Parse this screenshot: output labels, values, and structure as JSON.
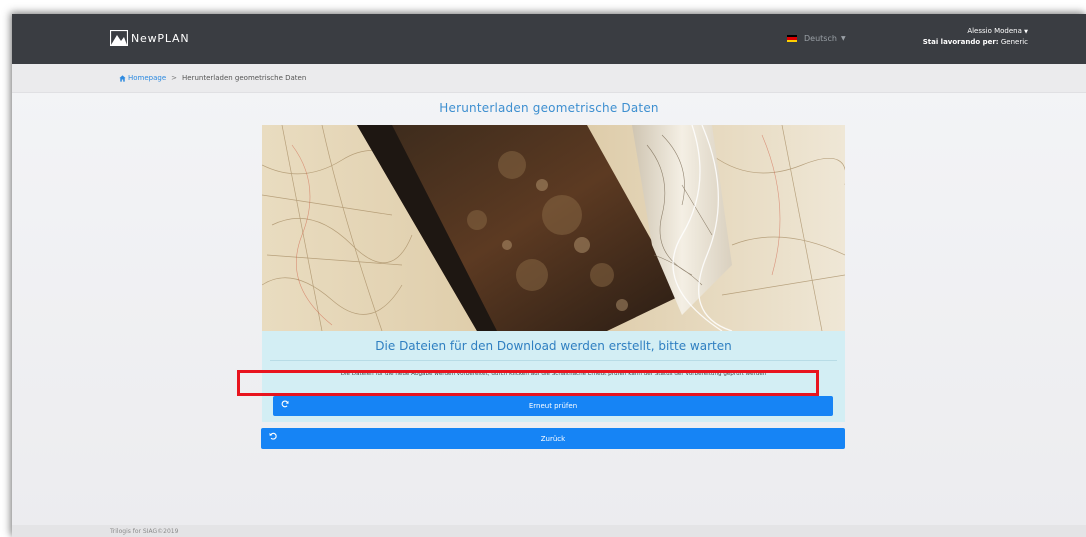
{
  "navbar": {
    "brand": "NewPLAN",
    "language": "Deutsch",
    "user_name": "Alessio Modena",
    "working_for_label": "Stai lavorando per:",
    "working_for_value": "Generic"
  },
  "breadcrumb": {
    "home": "Homepage",
    "separator": ">",
    "current": "Herunterladen geometrische Daten"
  },
  "page": {
    "title": "Herunterladen geometrische Daten"
  },
  "status": {
    "heading": "Die Dateien für den Download werden erstellt, bitte warten",
    "text": "Die Dateien für die neue Abgabe werden vorbereitet, durch Klicken auf die Schaltfläche Erneut prüfen kann der Status der Vorbereitung geprüft werden"
  },
  "buttons": {
    "retry": "Erneut prüfen",
    "back": "Zurück"
  },
  "footer": {
    "text": "Trilogis for SIAG©2019"
  },
  "colors": {
    "navbar": "#3a3d42",
    "accent": "#1684f5",
    "title": "#3d8fd0",
    "status_panel": "#d3eef4",
    "highlight": "#e8141e"
  },
  "icons": {
    "brand": "newplan-logo-icon",
    "language": "german-flag-icon",
    "home": "home-icon",
    "retry": "refresh-icon",
    "back": "undo-icon"
  }
}
